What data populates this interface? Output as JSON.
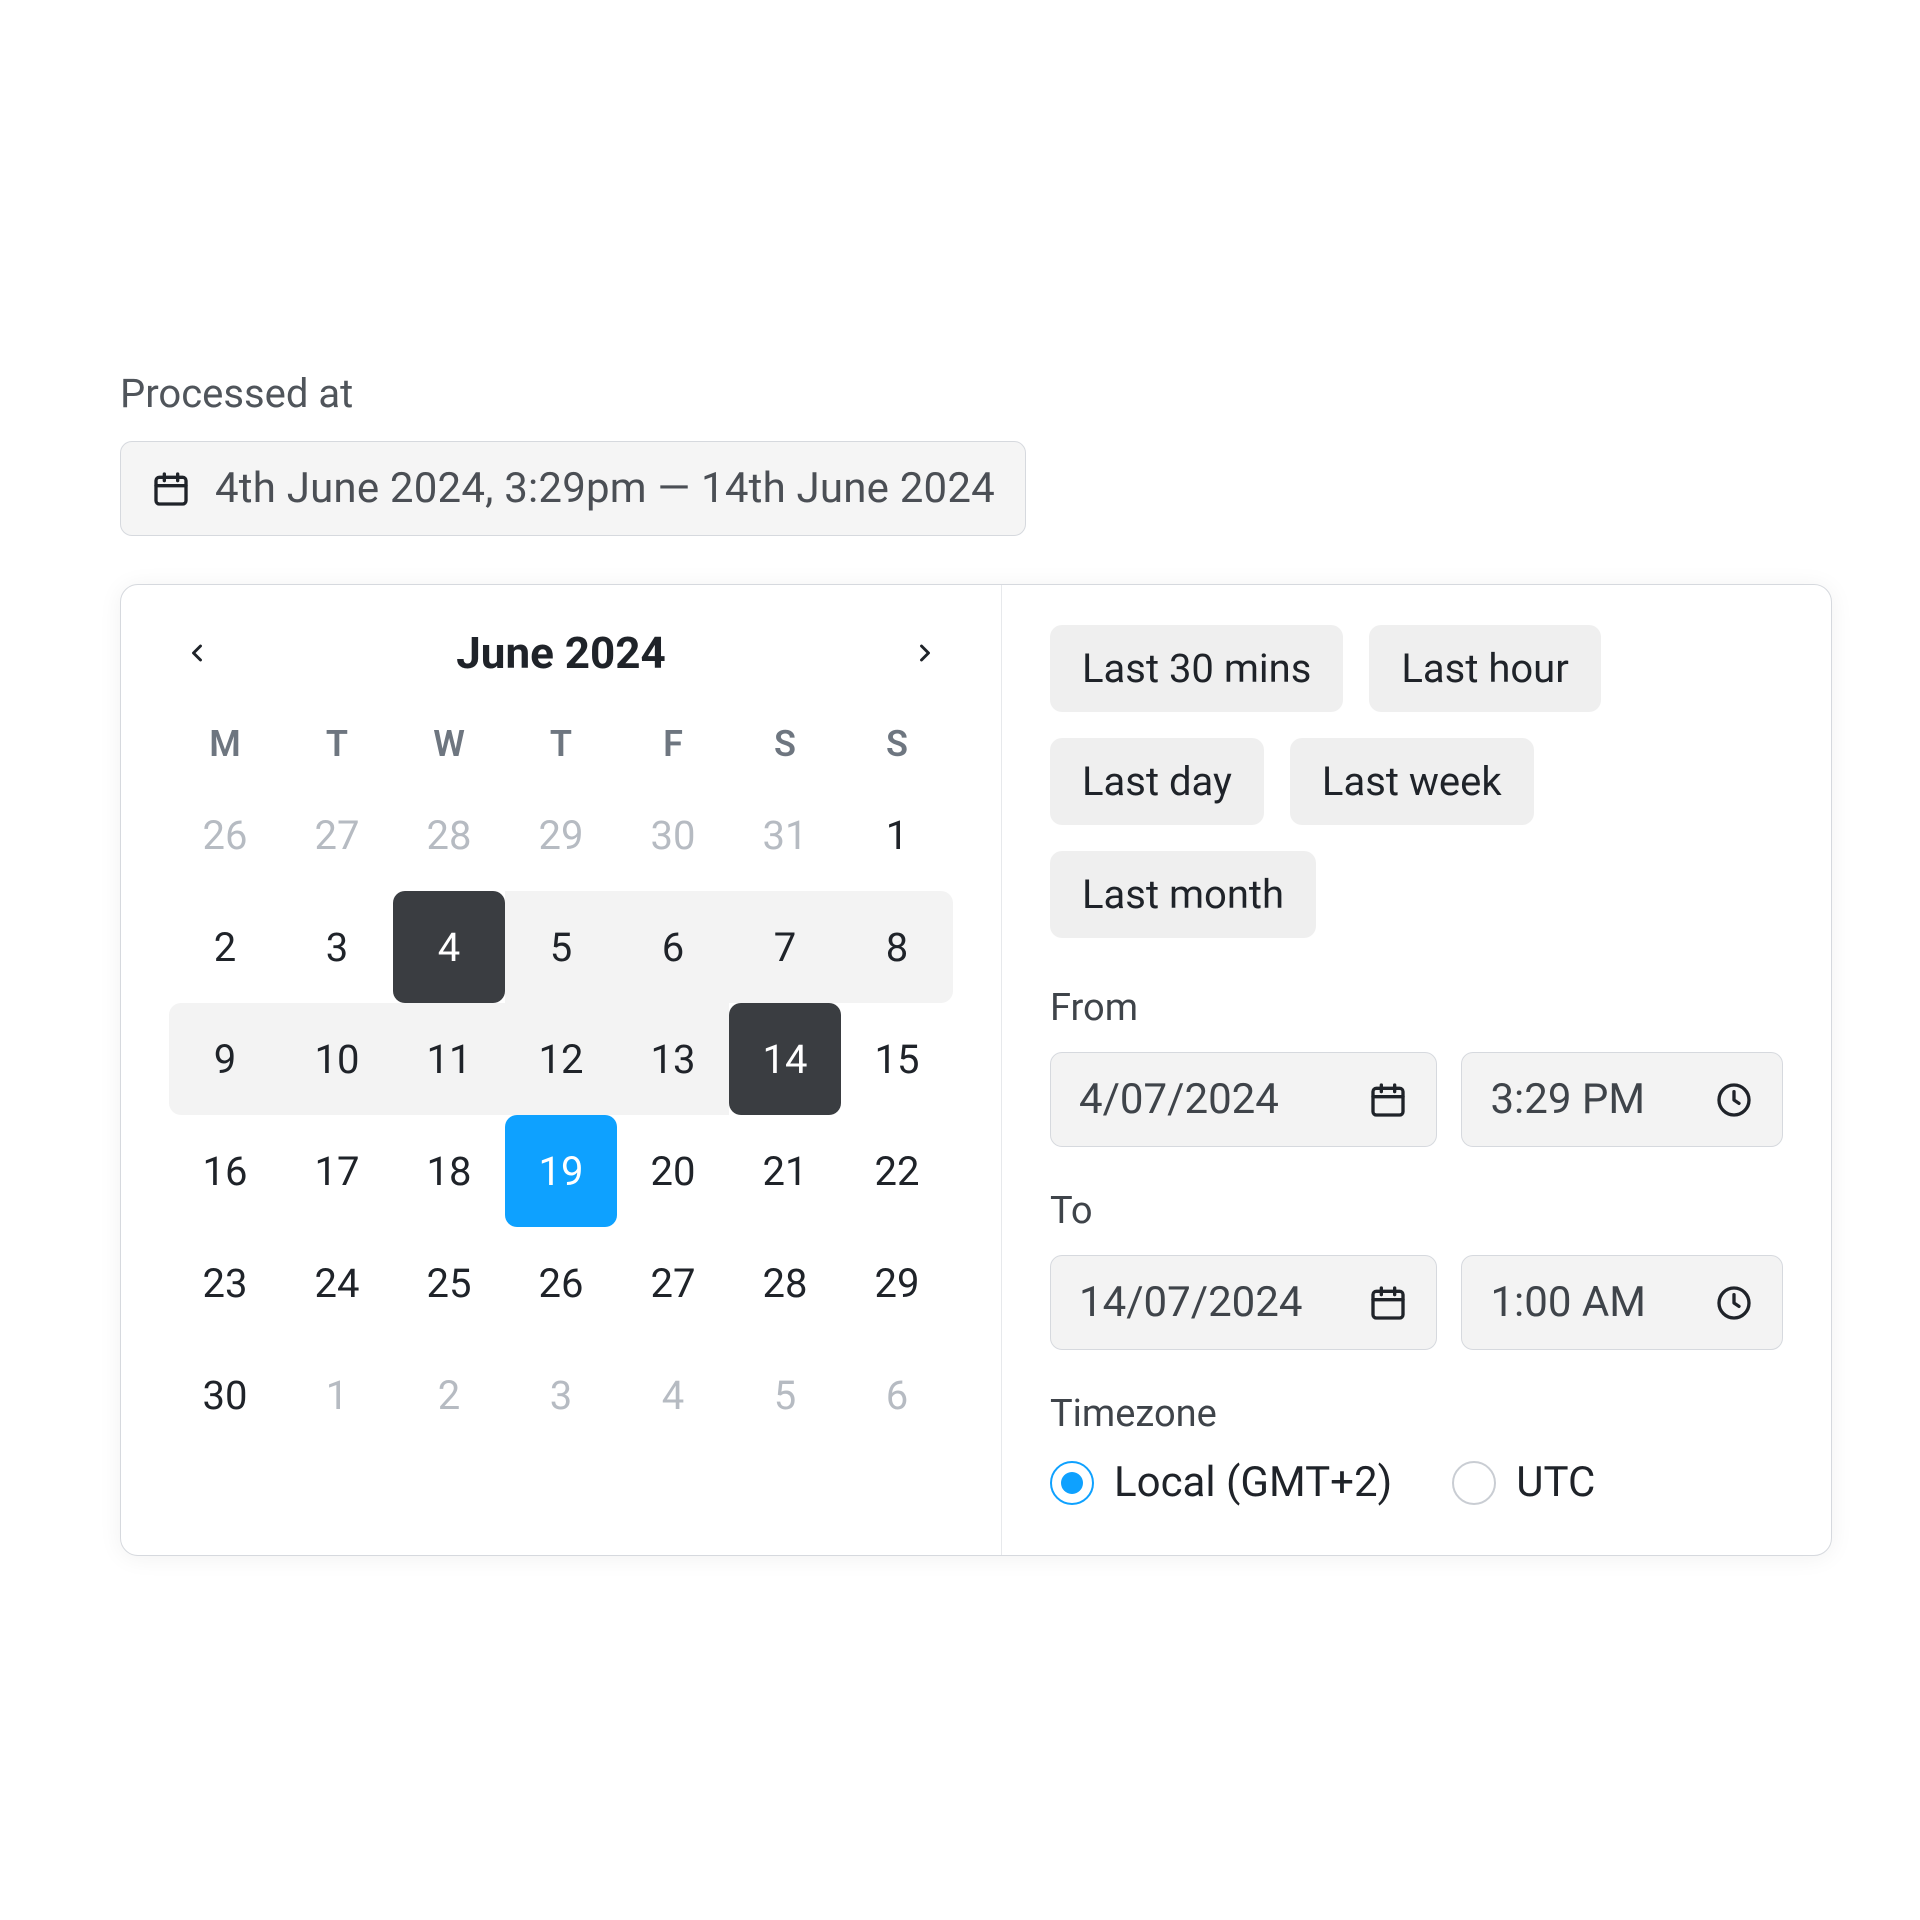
{
  "label": "Processed at",
  "trigger": {
    "text": "4th June 2024, 3:29pm — 14th June 2024"
  },
  "calendar": {
    "title": "June 2024",
    "dow": [
      "M",
      "T",
      "W",
      "T",
      "F",
      "S",
      "S"
    ],
    "days": [
      {
        "n": "26",
        "other": true
      },
      {
        "n": "27",
        "other": true
      },
      {
        "n": "28",
        "other": true
      },
      {
        "n": "29",
        "other": true
      },
      {
        "n": "30",
        "other": true
      },
      {
        "n": "31",
        "other": true
      },
      {
        "n": "1"
      },
      {
        "n": "2"
      },
      {
        "n": "3"
      },
      {
        "n": "4",
        "rangeStart": true,
        "selDark": true
      },
      {
        "n": "5",
        "inRange": true
      },
      {
        "n": "6",
        "inRange": true
      },
      {
        "n": "7",
        "inRange": true
      },
      {
        "n": "8",
        "inRange": true,
        "rangeRight": true
      },
      {
        "n": "9",
        "inRange": true,
        "rangeLeft": true
      },
      {
        "n": "10",
        "inRange": true
      },
      {
        "n": "11",
        "inRange": true
      },
      {
        "n": "12",
        "inRange": true
      },
      {
        "n": "13",
        "inRange": true
      },
      {
        "n": "14",
        "rangeEnd": true,
        "selDark": true
      },
      {
        "n": "15"
      },
      {
        "n": "16"
      },
      {
        "n": "17"
      },
      {
        "n": "18"
      },
      {
        "n": "19",
        "today": true
      },
      {
        "n": "20"
      },
      {
        "n": "21"
      },
      {
        "n": "22"
      },
      {
        "n": "23"
      },
      {
        "n": "24"
      },
      {
        "n": "25"
      },
      {
        "n": "26"
      },
      {
        "n": "27"
      },
      {
        "n": "28"
      },
      {
        "n": "29"
      },
      {
        "n": "30"
      },
      {
        "n": "1",
        "other": true
      },
      {
        "n": "2",
        "other": true
      },
      {
        "n": "3",
        "other": true
      },
      {
        "n": "4",
        "other": true
      },
      {
        "n": "5",
        "other": true
      },
      {
        "n": "6",
        "other": true
      }
    ]
  },
  "presets": [
    "Last 30 mins",
    "Last hour",
    "Last day",
    "Last week",
    "Last month"
  ],
  "from": {
    "label": "From",
    "date": "4/07/2024",
    "time": "3:29 PM"
  },
  "to": {
    "label": "To",
    "date": "14/07/2024",
    "time": "1:00 AM"
  },
  "timezone": {
    "label": "Timezone",
    "options": [
      {
        "label": "Local (GMT+2)",
        "selected": true
      },
      {
        "label": "UTC",
        "selected": false
      }
    ]
  }
}
